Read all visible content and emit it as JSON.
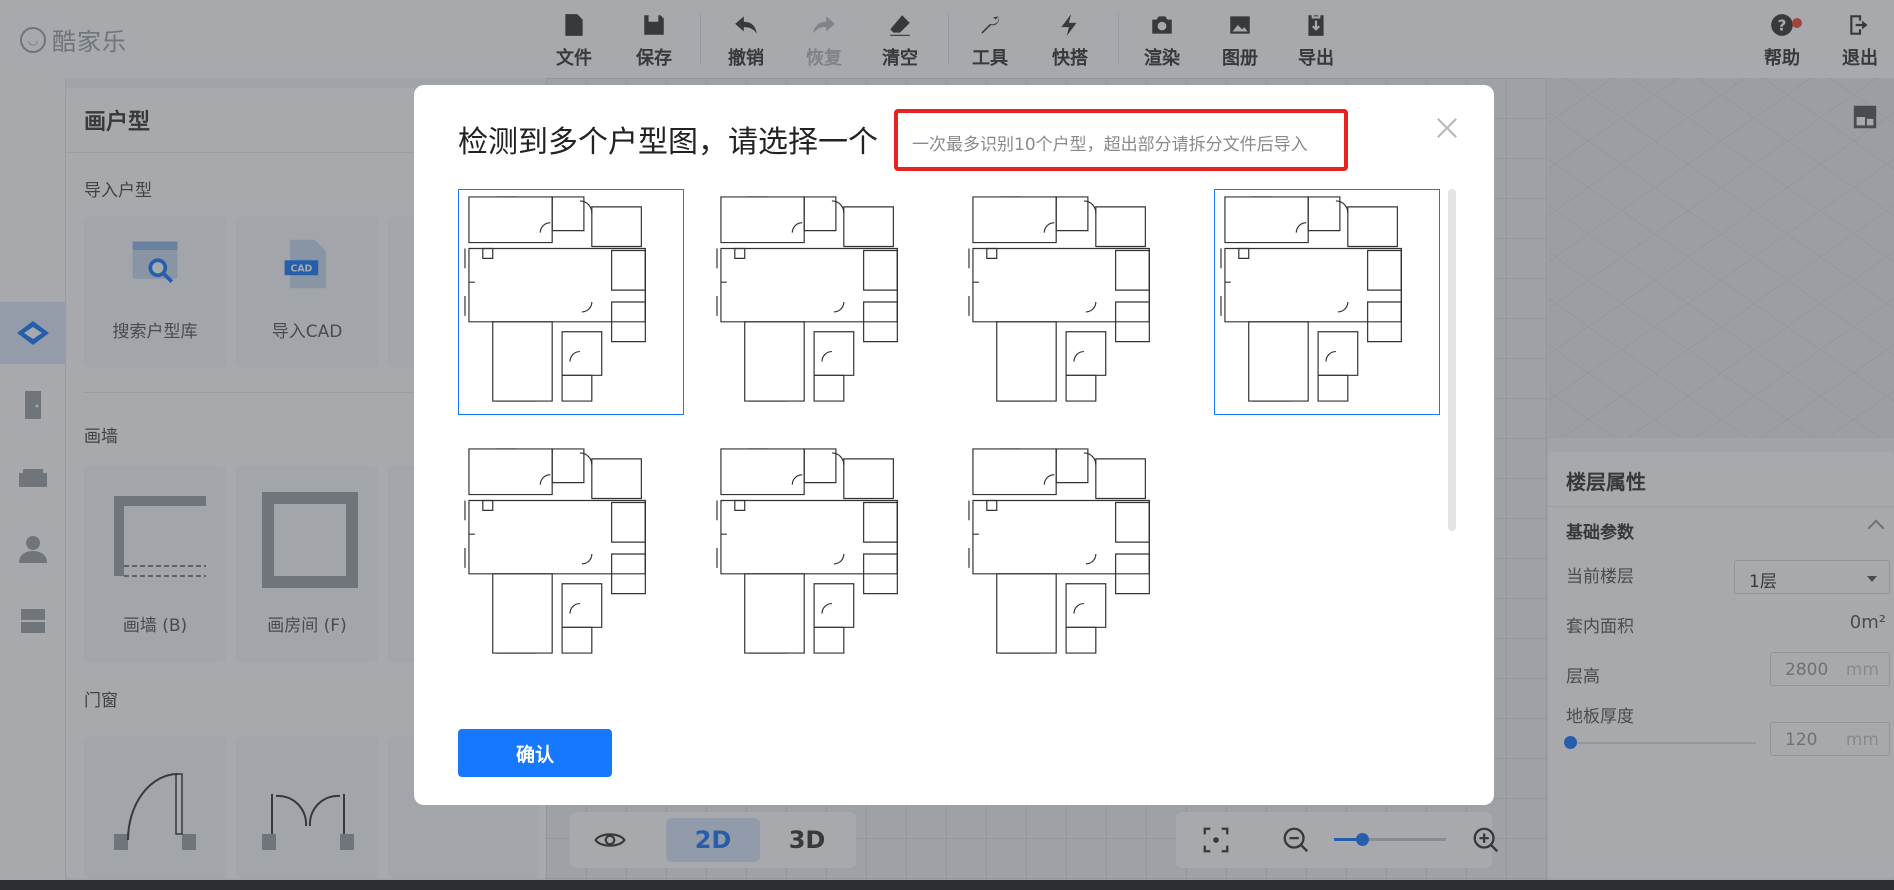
{
  "app": {
    "logo_text": "酷家乐",
    "logo_icon": "kujiale-logo-icon"
  },
  "toolbar": {
    "items": [
      {
        "label": "文件",
        "icon": "file-icon",
        "enabled": true
      },
      {
        "label": "保存",
        "icon": "save-icon",
        "enabled": true
      },
      {
        "label": "撤销",
        "icon": "undo-icon",
        "enabled": true
      },
      {
        "label": "恢复",
        "icon": "redo-icon",
        "enabled": false
      },
      {
        "label": "清空",
        "icon": "eraser-icon",
        "enabled": true
      },
      {
        "label": "工具",
        "icon": "wrench-icon",
        "enabled": true
      },
      {
        "label": "快搭",
        "icon": "lightning-icon",
        "enabled": true
      },
      {
        "label": "渲染",
        "icon": "camera-icon",
        "enabled": true
      },
      {
        "label": "图册",
        "icon": "image-icon",
        "enabled": true
      },
      {
        "label": "导出",
        "icon": "export-icon",
        "enabled": true
      }
    ],
    "help_label": "帮助",
    "exit_label": "退出"
  },
  "left_panel": {
    "title": "画户型",
    "import_section": "导入户型",
    "search_library": "搜索户型库",
    "import_cad": "导入CAD",
    "cad_badge": "CAD",
    "wall_section": "画墙",
    "draw_wall": "画墙 (B)",
    "draw_room": "画房间 (F)",
    "door_section": "门窗"
  },
  "canvas": {
    "mode_2d": "2D",
    "mode_3d": "3D",
    "zoom_level": 0.25
  },
  "properties": {
    "title": "楼层属性",
    "section": "基础参数",
    "current_floor_label": "当前楼层",
    "current_floor_value": "1层",
    "inner_area_label": "套内面积",
    "inner_area_value": "0m²",
    "floor_height_label": "层高",
    "floor_height_value": "2800",
    "floor_height_unit": "mm",
    "slab_thickness_label": "地板厚度",
    "slab_thickness_value": "120",
    "slab_thickness_unit": "mm"
  },
  "modal": {
    "title": "检测到多个户型图，请选择一个",
    "hint": "一次最多识别10个户型，超出部分请拆分文件后导入",
    "confirm": "确认",
    "floorplans": [
      {
        "selected": true
      },
      {
        "selected": false
      },
      {
        "selected": false
      },
      {
        "selected": true
      },
      {
        "selected": false
      },
      {
        "selected": false
      },
      {
        "selected": false
      }
    ]
  },
  "colors": {
    "accent": "#1677ff",
    "highlight": "#e8231f",
    "badge": "#f5483b"
  }
}
